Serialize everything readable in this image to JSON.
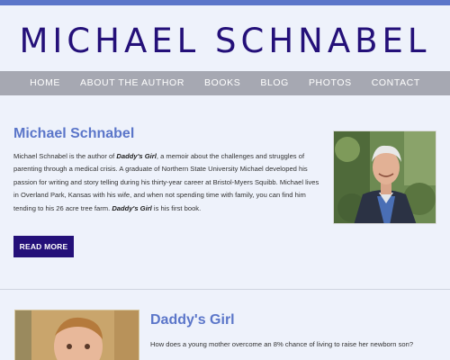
{
  "site": {
    "title": "MICHAEL SCHNABEL",
    "accent_color": "#5b76c9",
    "title_color": "#241079"
  },
  "nav": {
    "items": [
      "HOME",
      "ABOUT THE AUTHOR",
      "BOOKS",
      "BLOG",
      "PHOTOS",
      "CONTACT"
    ]
  },
  "author": {
    "name": "Michael Schnabel",
    "bio_1": "Michael Schnabel is the author of ",
    "bio_book": "Daddy's Girl",
    "bio_2": ", a memoir about the challenges and struggles of parenting through a medical crisis. A graduate of Northern State University Michael developed his passion for writing and story telling during his thirty-year career at Bristol-Myers Squibb. Michael lives in Overland Park, Kansas with his wife, and when not spending time with family, you can find him tending to his 26 acre tree farm. ",
    "bio_book_2": "Daddy's Girl",
    "bio_3": " is his first book.",
    "read_more": "READ MORE"
  },
  "book": {
    "title": "Daddy's Girl",
    "description": "How does a young mother overcome an 8% chance of living to raise her newborn son?"
  }
}
